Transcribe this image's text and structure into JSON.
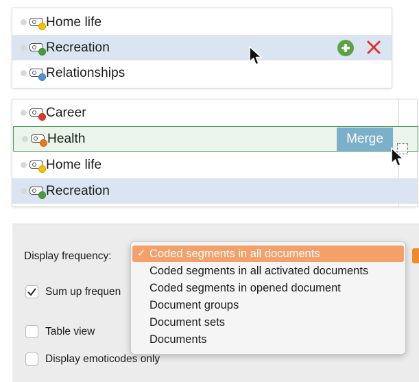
{
  "panel_top": {
    "rows": [
      {
        "label": "Home life",
        "color": "#f2c100",
        "selected": false
      },
      {
        "label": "Recreation",
        "color": "#4a9c3a",
        "selected": true
      },
      {
        "label": "Relationships",
        "color": "#4c93d4",
        "selected": false
      }
    ],
    "actions": {
      "add_icon": "plus-circle-icon",
      "delete_icon": "x-icon"
    }
  },
  "panel_middle": {
    "rows": [
      {
        "label": "Career",
        "color": "#e5362a"
      },
      {
        "label": "Health",
        "color": "#e87a1c"
      },
      {
        "label": "Home life",
        "color": "#f2c100"
      },
      {
        "label": "Recreation",
        "color": "#4a9c3a"
      }
    ],
    "merge_label": "Merge"
  },
  "options": {
    "display_frequency_label": "Display frequency:",
    "sum_up_label": "Sum up frequen",
    "sum_up_checked": true,
    "table_view_label": "Table view",
    "table_view_checked": false,
    "emoticodes_label": "Display emoticodes only",
    "emoticodes_checked": false,
    "accent_color": "#ef8a2f"
  },
  "dropdown": {
    "check_glyph": "✓",
    "options": [
      "Coded segments in all documents",
      "Coded segments in all activated documents",
      "Coded segments in opened document",
      "Document groups",
      "Document sets",
      "Documents"
    ],
    "selected_index": 0,
    "highlight_color": "#f4a06b"
  }
}
